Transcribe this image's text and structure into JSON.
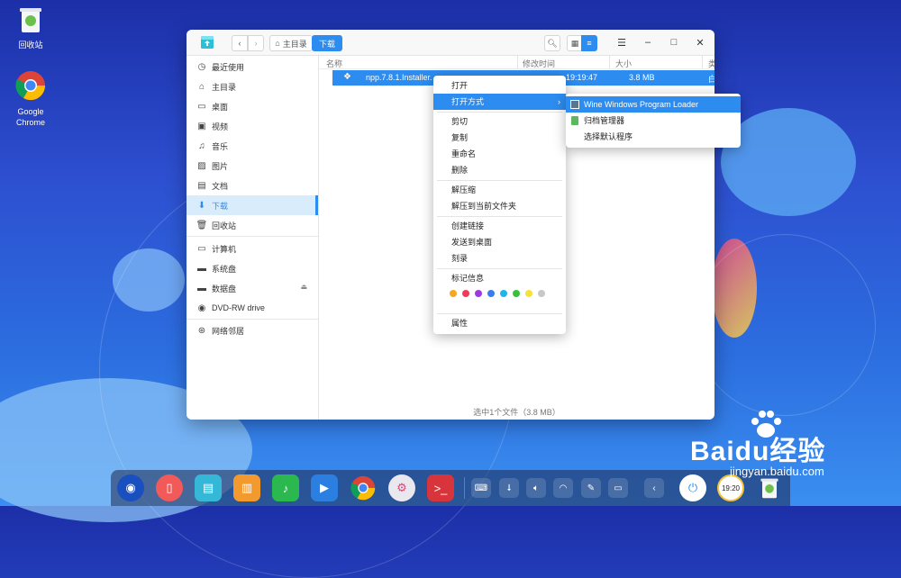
{
  "desktop": {
    "icons": [
      {
        "label": "回收站",
        "icon": "trash-icon"
      },
      {
        "label": "Google Chrome",
        "icon": "chrome-icon"
      }
    ]
  },
  "window": {
    "breadcrumb": [
      "主目录",
      "下载"
    ],
    "sidebar": [
      {
        "label": "最近使用",
        "icon": "clock-icon"
      },
      {
        "label": "主目录",
        "icon": "home-icon"
      },
      {
        "label": "桌面",
        "icon": "desktop-icon"
      },
      {
        "label": "视频",
        "icon": "video-icon"
      },
      {
        "label": "音乐",
        "icon": "music-icon"
      },
      {
        "label": "图片",
        "icon": "image-icon"
      },
      {
        "label": "文档",
        "icon": "document-icon"
      },
      {
        "label": "下载",
        "icon": "download-icon"
      },
      {
        "label": "回收站",
        "icon": "trash-icon"
      },
      {
        "label": "计算机",
        "icon": "computer-icon"
      },
      {
        "label": "系统盘",
        "icon": "disk-icon"
      },
      {
        "label": "数据盘",
        "icon": "disk-icon"
      },
      {
        "label": "DVD-RW drive",
        "icon": "disc-icon"
      },
      {
        "label": "网络邻居",
        "icon": "network-icon"
      }
    ],
    "columns": [
      "名称",
      "修改时间",
      "大小",
      "类"
    ],
    "file": {
      "name": "npp.7.8.1.Installer.",
      "time": "19:19:47",
      "size": "3.8 MB",
      "type": "白"
    },
    "status": "选中1个文件（3.8 MB）"
  },
  "context_menu": {
    "items": [
      "打开",
      "打开方式",
      "剪切",
      "复制",
      "重命名",
      "删除",
      "解压缩",
      "解压到当前文件夹",
      "创建链接",
      "发送到桌面",
      "刻录",
      "标记信息",
      "属性"
    ],
    "tag_colors": [
      "#f5a623",
      "#f03c5a",
      "#9b3ce0",
      "#3a7de8",
      "#1fb5e6",
      "#35c23a",
      "#f5e23a",
      "#c8c8c8"
    ]
  },
  "submenu": {
    "items": [
      "Wine Windows Program Loader",
      "归档管理器",
      "选择默认程序"
    ]
  },
  "dock": {
    "clock_text": "19:20"
  },
  "watermark": {
    "brand": "Baidu经验",
    "url": "jingyan.baidu.com"
  },
  "colors": {
    "accent": "#2d8cf0"
  }
}
